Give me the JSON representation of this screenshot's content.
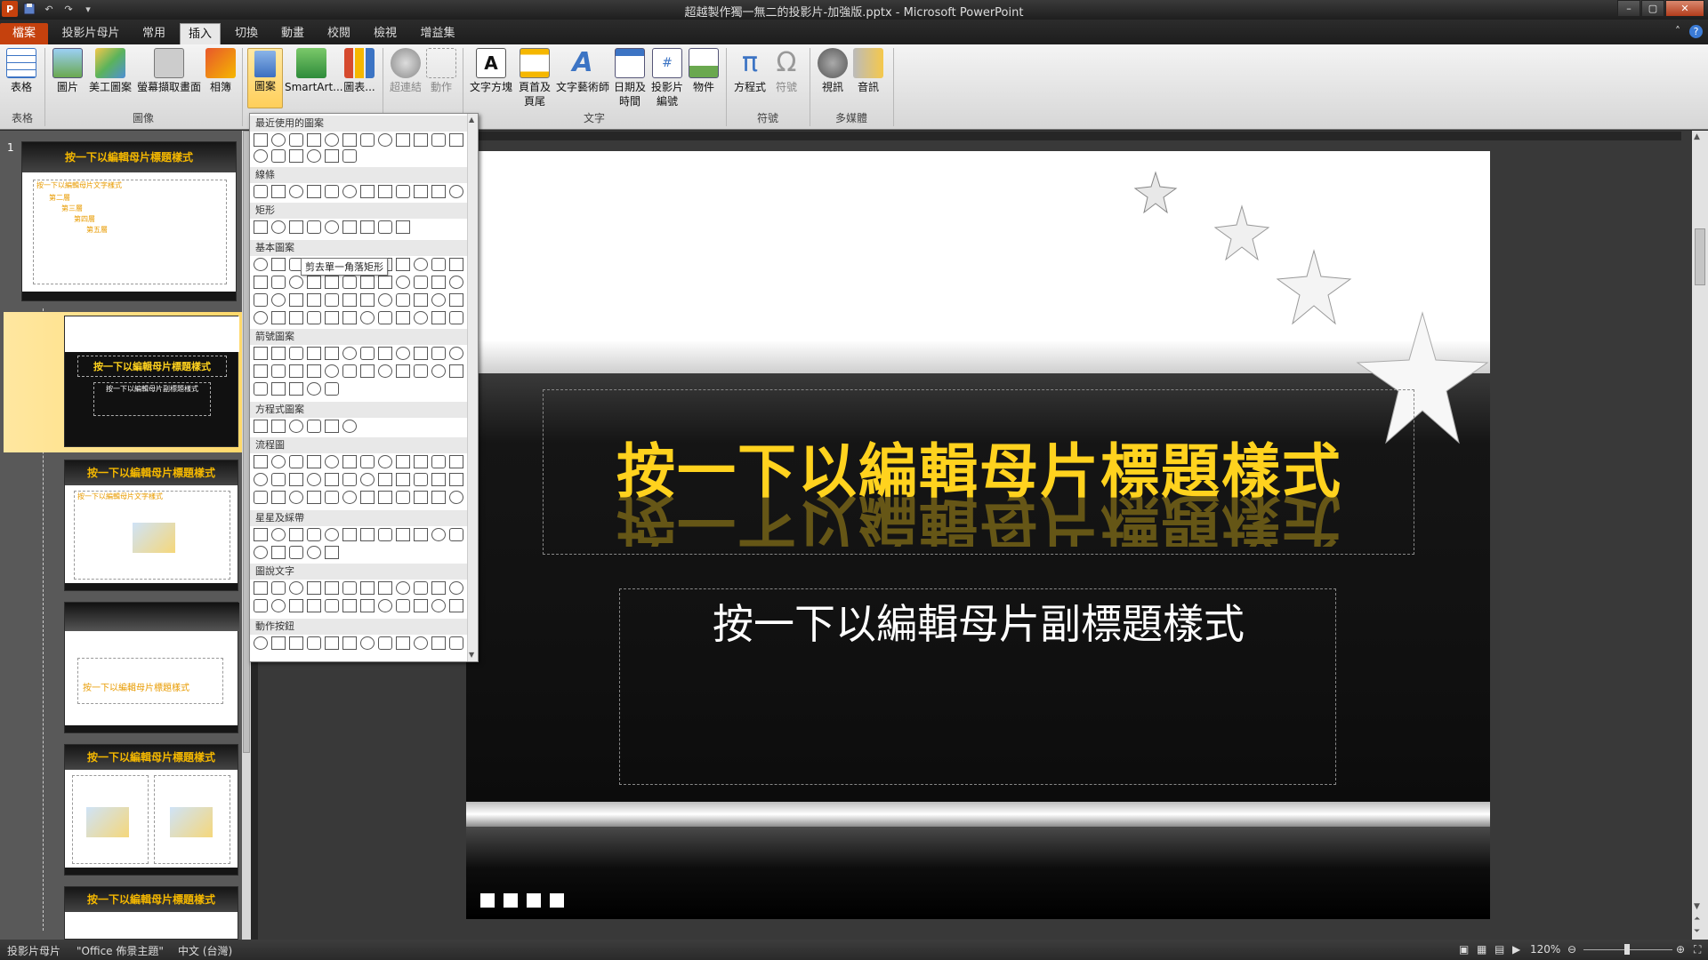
{
  "window": {
    "title": "超越製作獨一無二的投影片-加強版.pptx - Microsoft PowerPoint"
  },
  "qat": {
    "app_icon": "P",
    "save": "save-icon",
    "undo": "↶",
    "redo": "↷"
  },
  "window_buttons": {
    "minimize": "–",
    "restore": "▢",
    "close": "✕"
  },
  "tabs": [
    "檔案",
    "投影片母片",
    "常用",
    "插入",
    "切換",
    "動畫",
    "校閱",
    "檢視",
    "增益集"
  ],
  "ribbon": {
    "buttons": {
      "table": "表格",
      "picture": "圖片",
      "clipart": "美工圖案",
      "screenshot": "螢幕擷取畫面",
      "album": "相簿",
      "shapes": "圖案",
      "smartart": "SmartArt...",
      "chart": "圖表...",
      "hyperlink": "超連結",
      "action": "動作",
      "textbox": "文字方塊",
      "header_footer_1": "頁首及",
      "header_footer_2": "頁尾",
      "wordart": "文字藝術師",
      "datetime_1": "日期及",
      "datetime_2": "時間",
      "slidenum_1": "投影片",
      "slidenum_2": "編號",
      "object": "物件",
      "equation": "方程式",
      "symbol": "符號",
      "video": "視訊",
      "audio": "音訊"
    },
    "groups": {
      "tables": "表格",
      "images": "圖像",
      "text": "文字",
      "symbols": "符號",
      "media": "多媒體"
    }
  },
  "gallery": {
    "categories": [
      "最近使用的圖案",
      "線條",
      "矩形",
      "基本圖案",
      "箭號圖案",
      "方程式圖案",
      "流程圖",
      "星星及綵帶",
      "圖說文字",
      "動作按鈕"
    ],
    "tooltip": "剪去單一角落矩形"
  },
  "thumbnails": {
    "number": "1",
    "master_title": "按一下以編輯母片標題樣式",
    "master_text": "按一下以編輯母片文字樣式",
    "level2": "第二層",
    "level3": "第三層",
    "level4": "第四層",
    "level5": "第五層",
    "layout2_title": "按一下以編輯母片標題樣式",
    "layout2_sub": "按一下以編輯母片副標題樣式"
  },
  "slide": {
    "title": "按一下以編輯母片標題樣式",
    "subtitle": "按一下以編輯母片副標題樣式"
  },
  "status": {
    "view": "投影片母片",
    "theme": "\"Office 佈景主題\"",
    "language": "中文 (台灣)",
    "zoom": "120%"
  },
  "colors": {
    "file_tab": "#c5410d",
    "title_gold": "#ffd21e",
    "selected_thumb": "#ffd96b"
  }
}
